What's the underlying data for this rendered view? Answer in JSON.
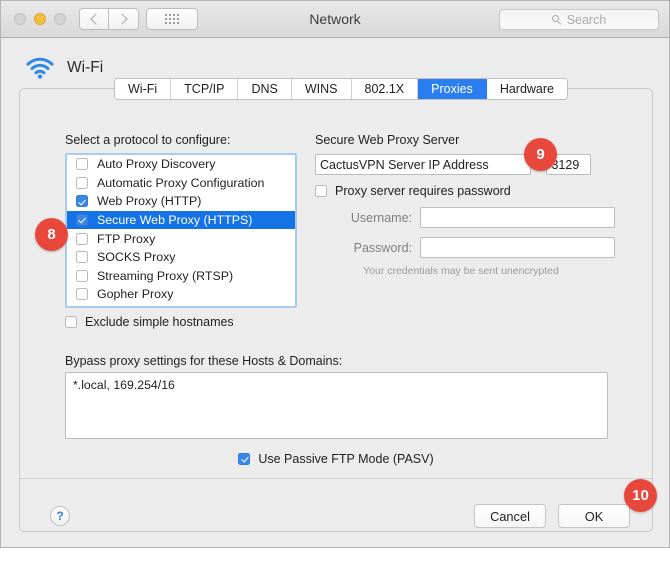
{
  "window": {
    "title": "Network",
    "search_placeholder": "Search",
    "traffic_lights": [
      "close-button",
      "minimize-button",
      "zoom-button"
    ]
  },
  "service": {
    "name": "Wi-Fi",
    "icon": "wifi-icon"
  },
  "tabs": [
    {
      "label": "Wi-Fi",
      "active": false
    },
    {
      "label": "TCP/IP",
      "active": false
    },
    {
      "label": "DNS",
      "active": false
    },
    {
      "label": "WINS",
      "active": false
    },
    {
      "label": "802.1X",
      "active": false
    },
    {
      "label": "Proxies",
      "active": true
    },
    {
      "label": "Hardware",
      "active": false
    }
  ],
  "protocols": {
    "label": "Select a protocol to configure:",
    "items": [
      {
        "label": "Auto Proxy Discovery",
        "checked": false,
        "selected": false
      },
      {
        "label": "Automatic Proxy Configuration",
        "checked": false,
        "selected": false
      },
      {
        "label": "Web Proxy (HTTP)",
        "checked": true,
        "selected": false
      },
      {
        "label": "Secure Web Proxy (HTTPS)",
        "checked": true,
        "selected": true
      },
      {
        "label": "FTP Proxy",
        "checked": false,
        "selected": false
      },
      {
        "label": "SOCKS Proxy",
        "checked": false,
        "selected": false
      },
      {
        "label": "Streaming Proxy (RTSP)",
        "checked": false,
        "selected": false
      },
      {
        "label": "Gopher Proxy",
        "checked": false,
        "selected": false
      }
    ],
    "exclude_simple_hostnames": {
      "label": "Exclude simple hostnames",
      "checked": false
    }
  },
  "proxy_server": {
    "title": "Secure Web Proxy Server",
    "host_value": "CactusVPN Server IP Address",
    "colon": ":",
    "port_value": "3129",
    "requires_password": {
      "label": "Proxy server requires password",
      "checked": false
    },
    "username_label": "Username:",
    "username_value": "",
    "password_label": "Password:",
    "password_value": "",
    "credentials_note": "Your credentials may be sent unencrypted"
  },
  "bypass": {
    "label": "Bypass proxy settings for these Hosts & Domains:",
    "value": "*.local, 169.254/16"
  },
  "passive_ftp": {
    "label": "Use Passive FTP Mode (PASV)",
    "checked": true
  },
  "footer": {
    "help_label": "?",
    "cancel_label": "Cancel",
    "ok_label": "OK"
  },
  "annotations": [
    {
      "number": "8"
    },
    {
      "number": "9"
    },
    {
      "number": "10"
    }
  ],
  "colors": {
    "accent_blue": "#2a7ef0",
    "selection_blue": "#1573e6",
    "badge_red": "#e8483c",
    "window_bg": "#ececec"
  }
}
